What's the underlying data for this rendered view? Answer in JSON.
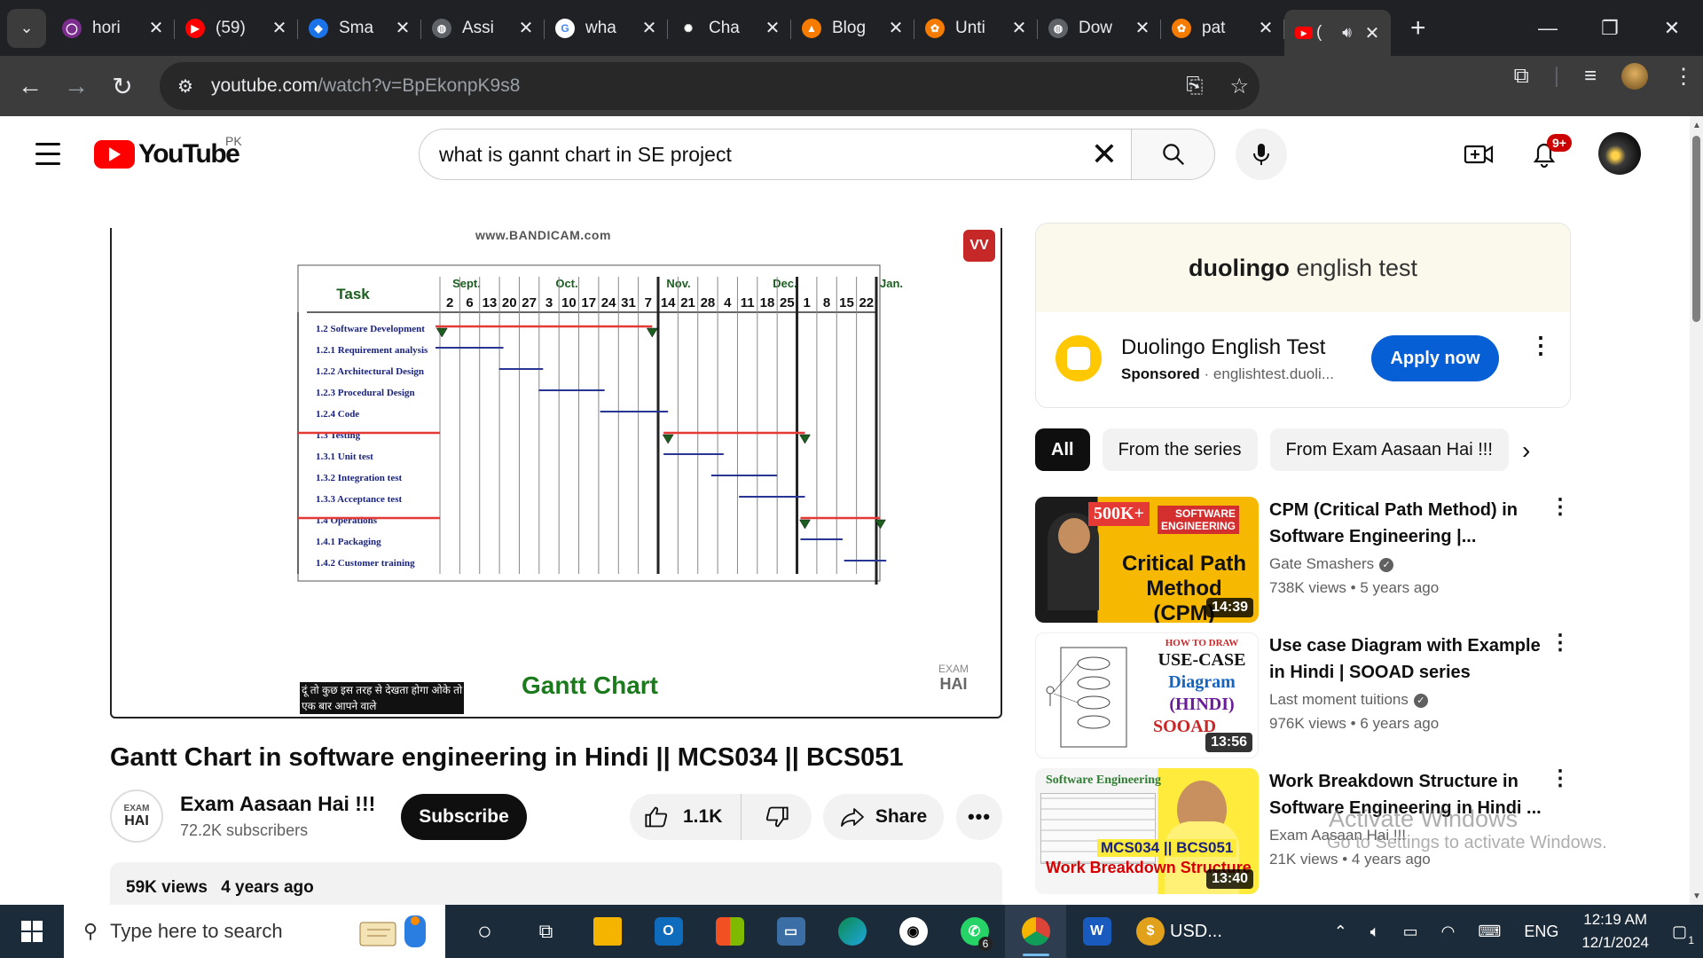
{
  "browser": {
    "tabs": [
      {
        "label": "hori",
        "fav_color": "#7b2d8e",
        "fav_glyph": "◯"
      },
      {
        "label": "(59)",
        "fav_color": "#ff0000",
        "fav_glyph": "▶"
      },
      {
        "label": "Sma",
        "fav_color": "#1a73e8",
        "fav_glyph": "◆"
      },
      {
        "label": "Assi",
        "fav_color": "#5f6368",
        "fav_glyph": "◍"
      },
      {
        "label": "wha",
        "fav_color": "#ffffff",
        "fav_glyph": "G"
      },
      {
        "label": "Cha",
        "fav_color": "#202124",
        "fav_glyph": "✺"
      },
      {
        "label": "Blog",
        "fav_color": "#f57c00",
        "fav_glyph": "▲"
      },
      {
        "label": "Unti",
        "fav_color": "#f57c00",
        "fav_glyph": "✿"
      },
      {
        "label": "Dow",
        "fav_color": "#5f6368",
        "fav_glyph": "◍"
      },
      {
        "label": "pat",
        "fav_color": "#f57c00",
        "fav_glyph": "✿"
      }
    ],
    "active_tab": {
      "label": "(",
      "fav_color": "#ff0000"
    },
    "url_host": "youtube.com",
    "url_path": "/watch?v=BpEkonpK9s8"
  },
  "youtube": {
    "logo_word": "YouTube",
    "country": "PK",
    "search_query": "what is gannt chart in SE project",
    "notif_count": "9+"
  },
  "video": {
    "watermark": "www.BANDICAM.com",
    "vv": "VV",
    "hindi_line1": "दूं तो कुछ इस तरह से देखता होगा ओके तो",
    "hindi_line2": "एक बार आपने वाले",
    "caption": "Gantt Chart",
    "exam_wm_small": "EXAM",
    "exam_wm_big": "HAI",
    "title": "Gantt Chart in software engineering in Hindi || MCS034 || BCS051",
    "channel": "Exam Aasaan Hai !!!",
    "subscribers": "72.2K subscribers",
    "subscribe_label": "Subscribe",
    "likes": "1.1K",
    "share_label": "Share",
    "views": "59K views",
    "age": "4 years ago",
    "avatar_small": "EXAM",
    "avatar_big": "HAI"
  },
  "gantt": {
    "task_header": "Task",
    "months": [
      "Sept.",
      "Oct.",
      "Nov.",
      "Dec.",
      "Jan."
    ],
    "days": [
      "2",
      "6",
      "13",
      "20",
      "27",
      "3",
      "10",
      "17",
      "24",
      "31",
      "7",
      "14",
      "21",
      "28",
      "4",
      "11",
      "18",
      "25",
      "1",
      "8",
      "15",
      "22"
    ],
    "tasks": [
      "1.2 Software Development",
      "1.2.1 Requirement analysis",
      "1.2.2 Architectural Design",
      "1.2.3 Procedural Design",
      "1.2.4 Code",
      "1.3 Testing",
      "1.3.1 Unit test",
      "1.3.2 Integration test",
      "1.3.3 Acceptance test",
      "1.4 Operations",
      "1.4.1 Packaging",
      "1.4.2 Customer training"
    ]
  },
  "ad": {
    "brand_bold": "duolingo",
    "brand_rest": " english test",
    "title": "Duolingo English Test",
    "sponsored": "Sponsored",
    "domain": "englishtest.duoli...",
    "apply_label": "Apply now"
  },
  "chips": [
    "All",
    "From the series",
    "From Exam Aasaan Hai !!!"
  ],
  "recommendations": [
    {
      "title": "CPM (Critical Path Method) in Software Engineering |...",
      "channel": "Gate Smashers",
      "views": "738K views",
      "age": "5 years ago",
      "duration": "14:39",
      "thumb_badge": "500K+",
      "thumb_tag1": "SOFTWARE",
      "thumb_tag2": "ENGINEERING",
      "thumb_line1": "Critical Path",
      "thumb_line2": "Method (CPM)",
      "verified": true
    },
    {
      "title": "Use case Diagram with Example in Hindi | SOOAD series",
      "channel": "Last moment tuitions",
      "views": "976K views",
      "age": "6 years ago",
      "duration": "13:56",
      "thumb_line0": "HOW TO DRAW",
      "thumb_line1": "USE-CASE",
      "thumb_line2": "Diagram",
      "thumb_line3": "(HINDI)",
      "thumb_line4": "SOOAD",
      "verified": true
    },
    {
      "title": "Work Breakdown Structure in Software Engineering in Hindi ...",
      "channel": "Exam Aasaan Hai !!!",
      "views": "21K views",
      "age": "4 years ago",
      "duration": "13:40",
      "thumb_line0": "Software Engineering",
      "thumb_line1": "MCS034 || BCS051",
      "thumb_line2": "Work Breakdown Structure",
      "verified": false
    }
  ],
  "activate": {
    "line1": "Activate Windows",
    "line2": "Go to Settings to activate Windows."
  },
  "taskbar": {
    "search_placeholder": "Type here to search",
    "usd": "USD...",
    "lang": "ENG",
    "time": "12:19 AM",
    "date": "12/1/2024",
    "whatsapp_count": "6",
    "notif_count": "1"
  }
}
